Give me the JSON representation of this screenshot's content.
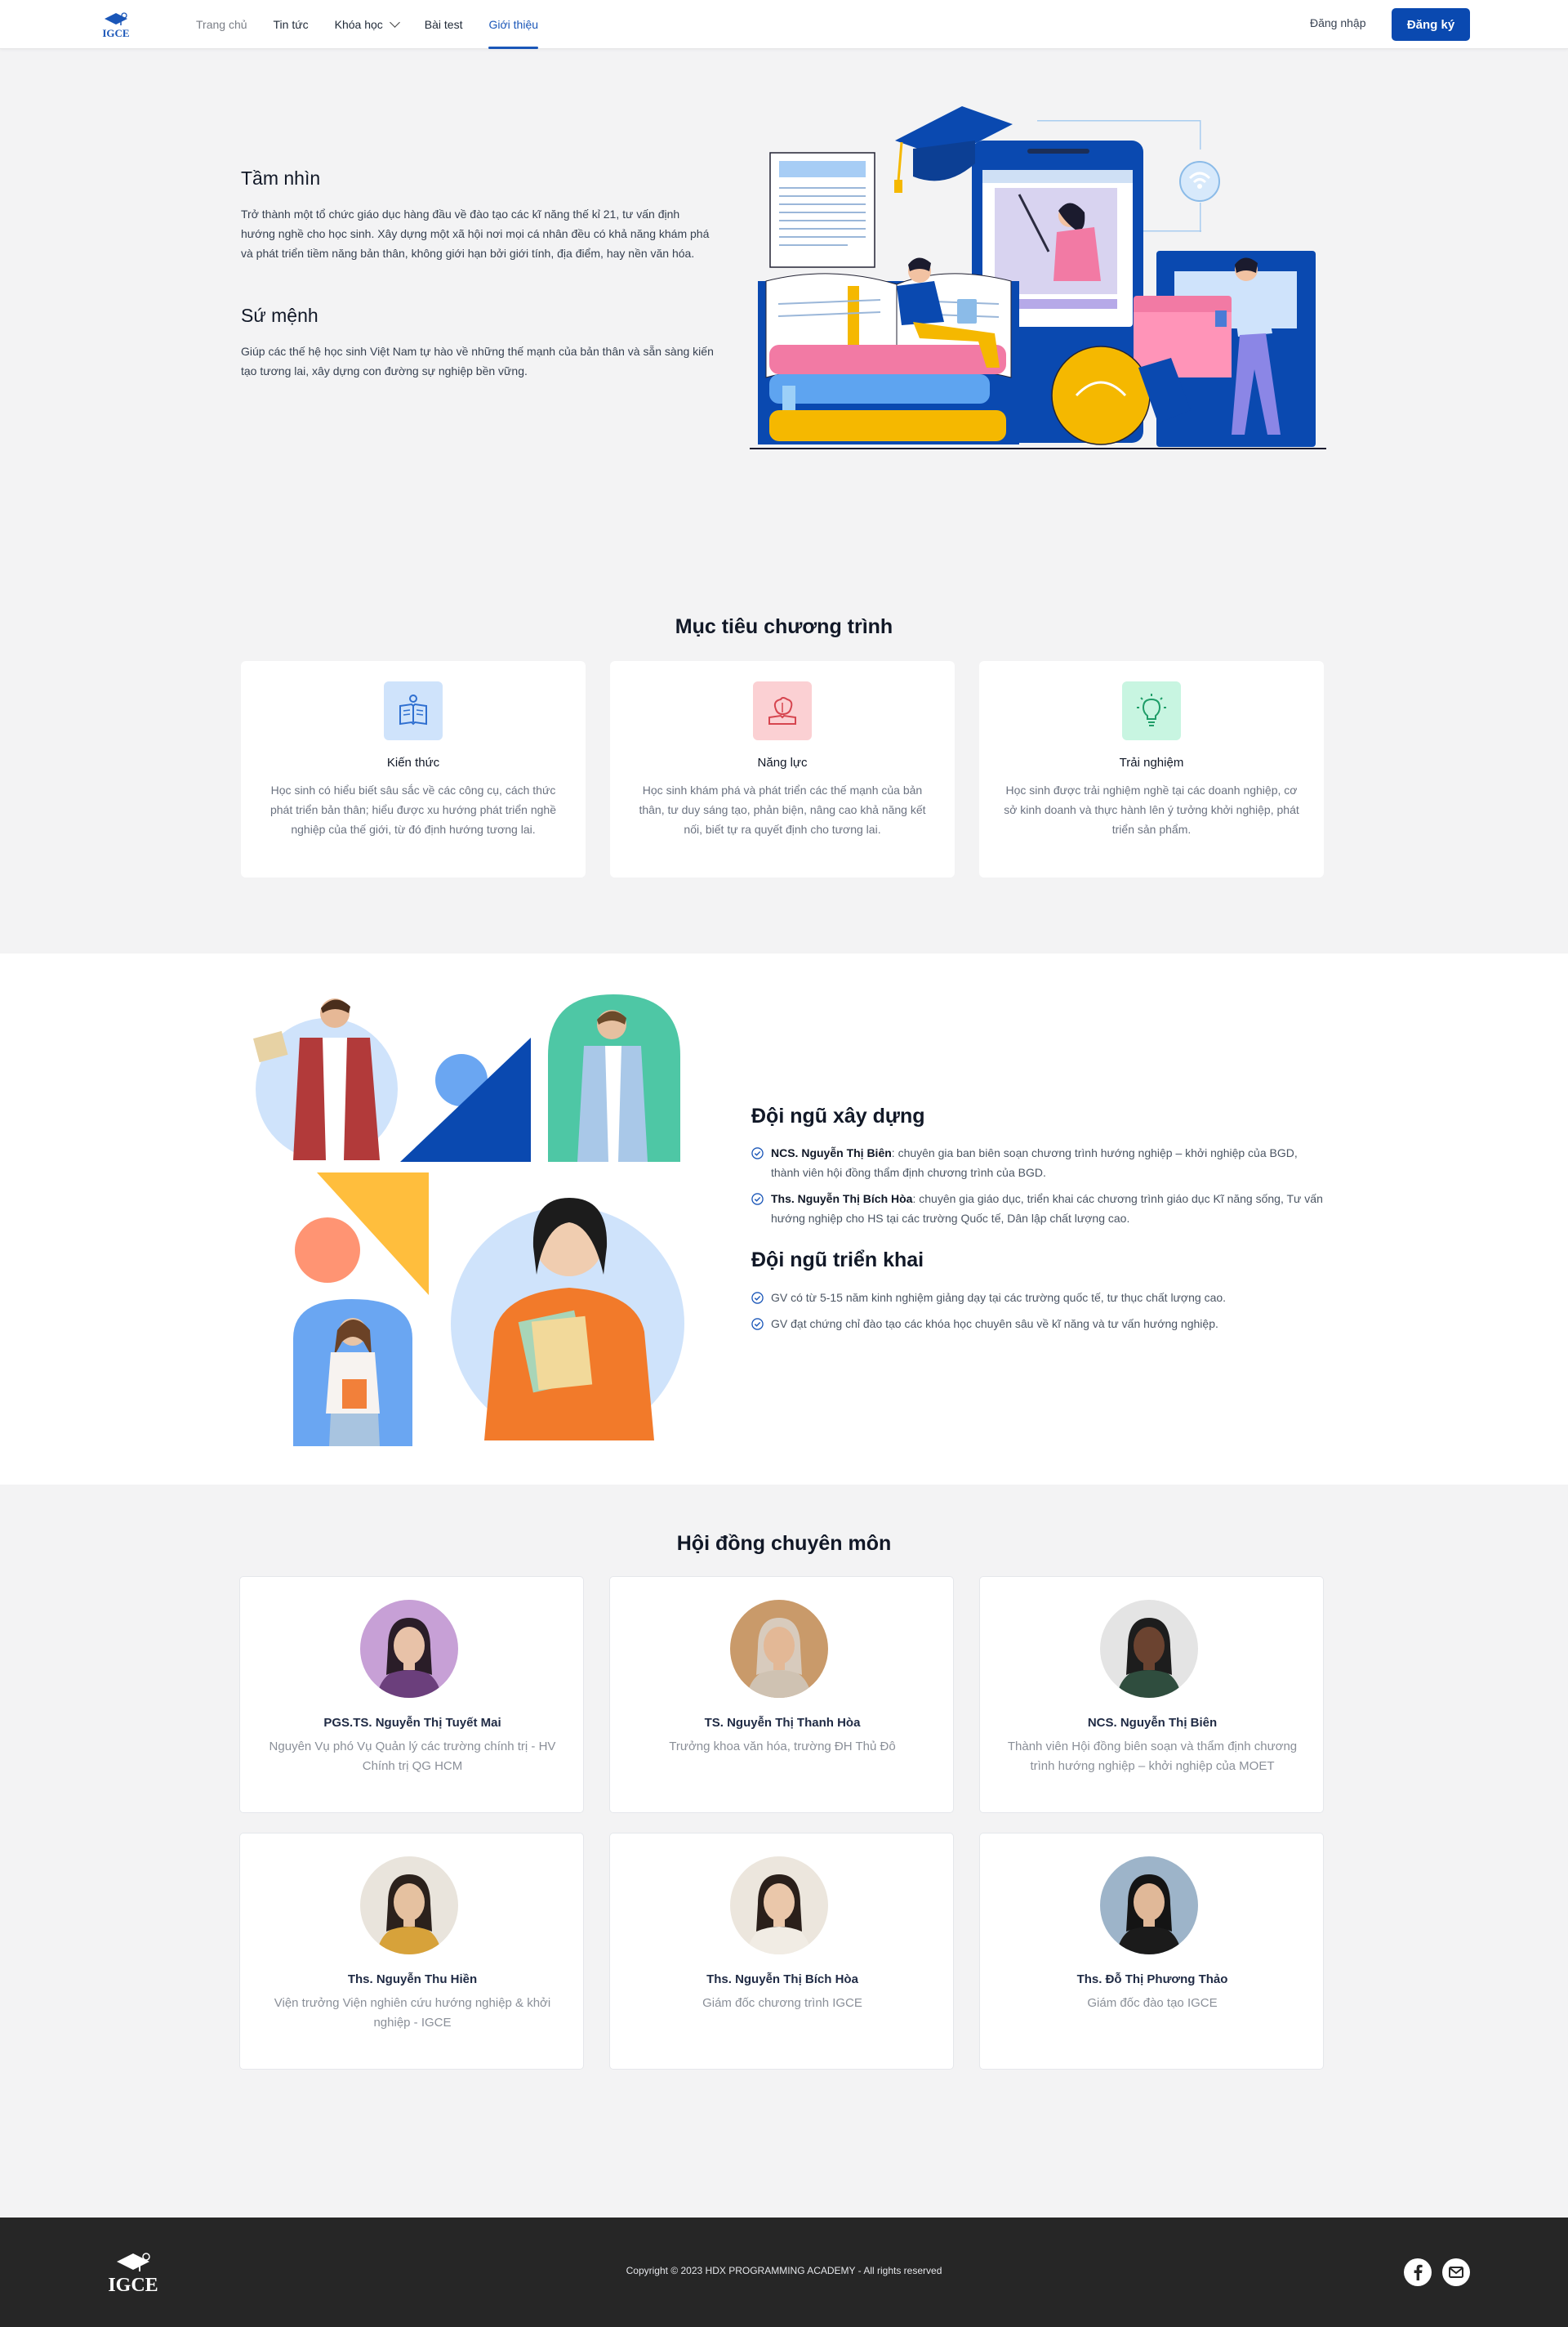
{
  "header": {
    "logo_text": "IGCE",
    "nav": [
      {
        "label": "Trang chủ"
      },
      {
        "label": "Tin tức"
      },
      {
        "label": "Khóa học"
      },
      {
        "label": "Bài test"
      },
      {
        "label": "Giới thiệu"
      }
    ],
    "active_nav": "Giới thiệu",
    "login_label": "Đăng nhập",
    "signup_label": "Đăng ký"
  },
  "vision": {
    "title": "Tầm nhìn",
    "text": "Trở thành một tổ chức giáo dục hàng đầu về đào tạo các kĩ năng thế kỉ 21, tư vấn định hướng nghề cho học sinh. Xây dựng một xã hội nơi mọi cá nhân đều có khả năng khám phá và phát triển tiềm năng bản thân, không giới hạn bởi giới tính, địa điểm, hay nền văn hóa."
  },
  "mission": {
    "title": "Sứ mệnh",
    "text": "Giúp các thế hệ học sinh Việt Nam tự hào về những thế mạnh của bản thân và sẵn sàng kiến tạo tương lai, xây dựng con đường sự nghiệp bền vững."
  },
  "objectives": {
    "title": "Mục tiêu chương trình",
    "items": [
      {
        "name": "Kiến thức",
        "icon": "book-lightbulb-icon",
        "icon_bg": "#cfe3fb",
        "icon_color": "#2f6fd0",
        "desc": "Học sinh có hiểu biết sâu sắc về các công cụ, cách thức phát triển bản thân; hiểu được xu hướng phát triển nghề nghiệp của thế giới, từ đó định hướng tương lai."
      },
      {
        "name": "Năng lực",
        "icon": "brain-book-icon",
        "icon_bg": "#fbd0d3",
        "icon_color": "#d6454f",
        "desc": "Học sinh khám phá và phát triển các thế mạnh của bản thân, tư duy sáng tạo, phản biện, nâng cao khả năng kết nối, biết tự ra quyết định cho tương lai."
      },
      {
        "name": "Trải nghiệm",
        "icon": "lightbulb-icon",
        "icon_bg": "#c8f5e1",
        "icon_color": "#1f9d68",
        "desc": "Học sinh được trải nghiệm nghề tại các doanh nghiệp, cơ sở kinh doanh và thực hành lên ý tưởng khởi nghiệp, phát triển sản phẩm."
      }
    ]
  },
  "team": {
    "build_title": "Đội ngũ xây dựng",
    "build_items": [
      {
        "name": "NCS. Nguyễn Thị Biên",
        "text": ": chuyên gia ban biên soạn chương trình hướng nghiệp – khởi nghiệp của BGD, thành viên hội đồng thẩm định chương trình của BGD."
      },
      {
        "name": "Ths. Nguyễn Thị Bích Hòa",
        "text": ": chuyên gia giáo dục, triển khai các chương trình giáo dục Kĩ năng sống, Tư vấn hướng nghiệp cho HS tại các trường Quốc tế, Dân lập chất lượng cao."
      }
    ],
    "deploy_title": "Đội ngũ triển khai",
    "deploy_items": [
      "GV có từ 5-15 năm kinh nghiệm giảng dạy tại các trường quốc tế, tư thục chất lượng cao.",
      "GV đạt chứng chỉ đào tạo các khóa học chuyên sâu về kĩ năng và tư vấn hướng nghiệp."
    ]
  },
  "council": {
    "title": "Hội đồng chuyên môn",
    "members": [
      {
        "name": "PGS.TS. Nguyễn Thị Tuyết Mai",
        "role": "Nguyên Vụ phó Vụ Quản lý các trường chính trị - HV Chính trị QG HCM",
        "bg": "#c7a0d6",
        "skin": "#e8c2a8",
        "hair": "#2a1d28",
        "shirt": "#6b3f7c"
      },
      {
        "name": "TS. Nguyễn Thị Thanh Hòa",
        "role": "Trưởng khoa văn hóa, trường ĐH Thủ Đô",
        "bg": "#c99a6a",
        "skin": "#e3b896",
        "hair": "#d8cbbd",
        "shirt": "#cfc2b2"
      },
      {
        "name": "NCS. Nguyễn Thị Biên",
        "role": "Thành viên Hội đồng biên soạn và thẩm định chương trình hướng nghiệp – khởi nghiệp của MOET",
        "bg": "#e4e4e4",
        "skin": "#6b4330",
        "hair": "#1d1d1d",
        "shirt": "#2f4d3e"
      },
      {
        "name": "Ths. Nguyễn Thu Hiền",
        "role": "Viện trưởng Viện nghiên cứu hướng nghiệp & khởi nghiệp - IGCE",
        "bg": "#e9e4dc",
        "skin": "#e5c1a0",
        "hair": "#2b211c",
        "shirt": "#d7a23a"
      },
      {
        "name": "Ths. Nguyễn Thị Bích Hòa",
        "role": "Giám đốc chương trình IGCE",
        "bg": "#ece6dd",
        "skin": "#eac7aa",
        "hair": "#2a1f1a",
        "shirt": "#f1ece4"
      },
      {
        "name": "Ths. Đỗ Thị Phương Thảo",
        "role": "Giám đốc đào tạo IGCE",
        "bg": "#9db4c9",
        "skin": "#e0b898",
        "hair": "#141414",
        "shirt": "#1b1b1b"
      }
    ]
  },
  "footer": {
    "logo_text": "IGCE",
    "copyright": "Copyright © 2023 HDX PROGRAMMING ACADEMY - All rights reserved",
    "socials": [
      {
        "icon": "facebook-icon"
      },
      {
        "icon": "mail-icon"
      }
    ]
  },
  "colors": {
    "brand": "#0a49b0",
    "page_bg": "#f3f3f4",
    "footer_bg": "#262626"
  }
}
